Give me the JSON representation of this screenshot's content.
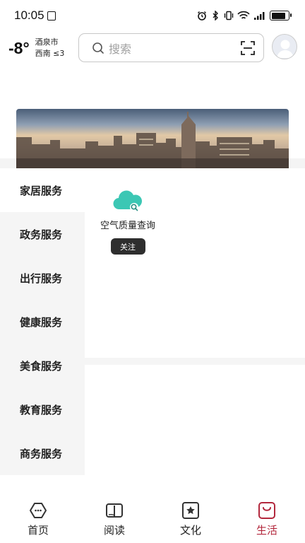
{
  "status_bar": {
    "time": "10:05"
  },
  "weather": {
    "temperature": "-8°",
    "city": "酒泉市",
    "wind": "西南 ≤3"
  },
  "search": {
    "placeholder": "搜索"
  },
  "sidebar": {
    "items": [
      {
        "label": "家居服务",
        "active": true
      },
      {
        "label": "政务服务",
        "active": false
      },
      {
        "label": "出行服务",
        "active": false
      },
      {
        "label": "健康服务",
        "active": false
      },
      {
        "label": "美食服务",
        "active": false
      },
      {
        "label": "教育服务",
        "active": false
      },
      {
        "label": "商务服务",
        "active": false
      }
    ]
  },
  "services": [
    {
      "name": "空气质量查询",
      "icon": "cloud-search-icon",
      "button": "关注"
    }
  ],
  "tabs": [
    {
      "label": "首页",
      "icon": "home-icon",
      "active": false
    },
    {
      "label": "阅读",
      "icon": "book-icon",
      "active": false
    },
    {
      "label": "文化",
      "icon": "star-icon",
      "active": false
    },
    {
      "label": "生活",
      "icon": "bag-icon",
      "active": true
    }
  ],
  "colors": {
    "accent": "#b3283d",
    "service_icon": "#3cc7b4",
    "follow_button": "#2e2e2e"
  }
}
